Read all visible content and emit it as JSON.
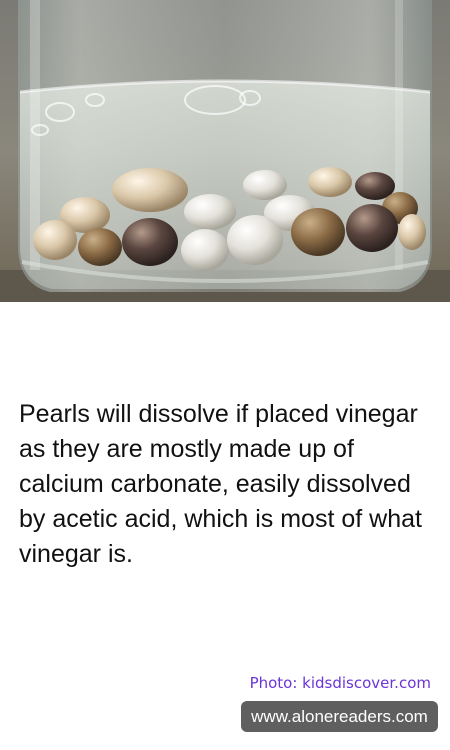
{
  "photo": {
    "subject": "pearls-in-vinegar-jar"
  },
  "caption": {
    "text": "Pearls will dissolve if placed vinegar as they are mostly made up of calcium carbonate, easily dissolved by acetic acid, which is most of what vinegar is."
  },
  "credit": {
    "text": "Photo: kidsdiscover.com"
  },
  "watermark": {
    "text": "www.alonereaders.com"
  },
  "colors": {
    "caption_text": "#111111",
    "credit_text": "#6b35d8",
    "watermark_bg": "#5f5f5f",
    "watermark_text": "#ffffff"
  }
}
